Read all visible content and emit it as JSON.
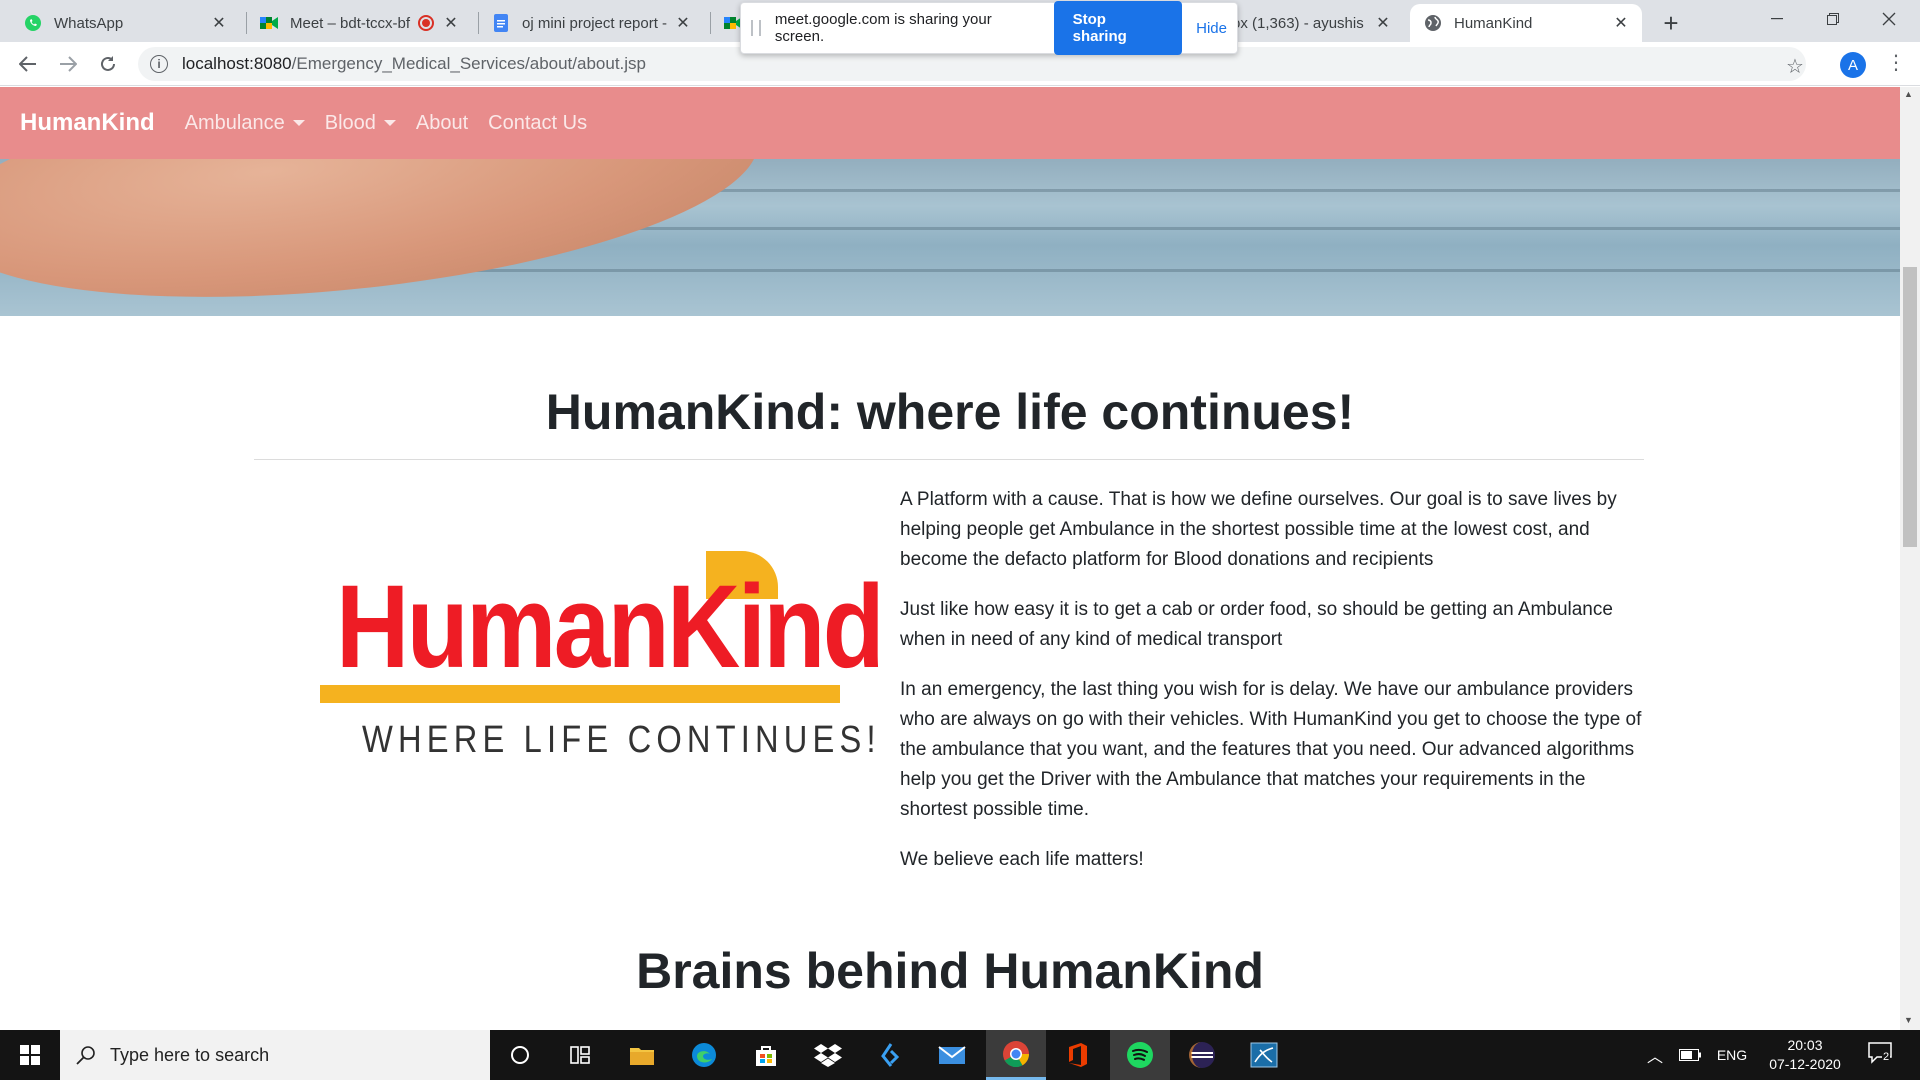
{
  "browser": {
    "tabs": [
      {
        "title": "WhatsApp",
        "icon": "whatsapp-icon"
      },
      {
        "title": "Meet – bdt-tccx-bf",
        "icon": "google-meet-icon"
      },
      {
        "title": "oj mini project report -",
        "icon": "google-docs-icon"
      },
      {
        "title": "",
        "icon": "google-meet-icon"
      },
      {
        "title": "ox (1,363) - ayushis",
        "icon": "gmail-icon"
      },
      {
        "title": "HumanKind",
        "icon": "globe-icon"
      }
    ],
    "share_bar": {
      "message": "meet.google.com is sharing your screen.",
      "stop_label": "Stop sharing",
      "hide_label": "Hide"
    },
    "url_host": "localhost:8080",
    "url_path": "/Emergency_Medical_Services/about/about.jsp",
    "profile_initial": "A"
  },
  "site": {
    "brand": "HumanKind",
    "nav": [
      {
        "label": "Ambulance",
        "dropdown": true
      },
      {
        "label": "Blood",
        "dropdown": true
      },
      {
        "label": "About",
        "dropdown": false
      },
      {
        "label": "Contact Us",
        "dropdown": false
      }
    ],
    "nav_color": "#e88c8c"
  },
  "main": {
    "title_bold": "HumanKind",
    "title_rest": ": where life continues!",
    "logo_wordmark": "HumanKind",
    "logo_tagline": "WHERE LIFE CONTINUES!",
    "paragraphs": [
      "A Platform with a cause. That is how we define ourselves. Our goal is to save lives by helping people get Ambulance in the shortest possible time at the lowest cost, and become the defacto platform for Blood donations and recipients",
      "Just like how easy it is to get a cab or order food, so should be getting an Ambulance when in need of any kind of medical transport",
      "In an emergency, the last thing you wish for is delay. We have our ambulance providers who are always on go with their vehicles. With HumanKind you get to choose the type of the ambulance that you want, and the features that you need. Our advanced algorithms help you get the Driver with the Ambulance that matches your requirements in the shortest possible time.",
      "We believe each life matters!"
    ],
    "section2_title": "Brains behind HumanKind"
  },
  "taskbar": {
    "search_placeholder": "Type here to search",
    "language": "ENG",
    "time": "20:03",
    "date": "07-12-2020",
    "notification_count": "2",
    "pinned": [
      "cortana-icon",
      "task-view-icon",
      "file-explorer-icon",
      "edge-icon",
      "store-icon",
      "dropbox-icon",
      "vscode-icon",
      "mail-icon",
      "chrome-icon",
      "office-icon",
      "spotify-icon",
      "eclipse-icon",
      "sql-tool-icon"
    ]
  }
}
